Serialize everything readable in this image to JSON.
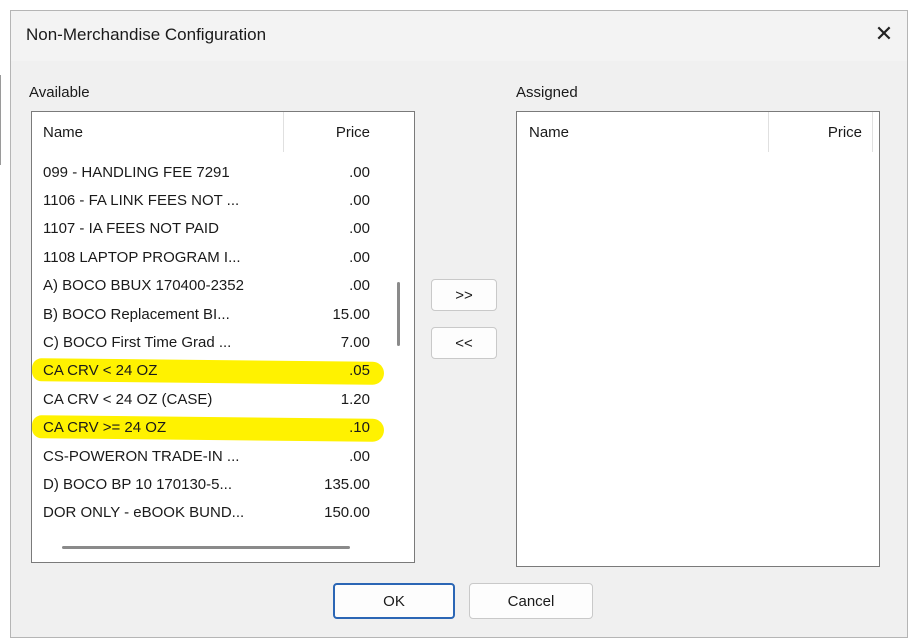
{
  "window": {
    "title": "Non-Merchandise Configuration",
    "close_glyph": "✕"
  },
  "available": {
    "label": "Available",
    "columns": {
      "name": "Name",
      "price": "Price"
    },
    "rows": [
      {
        "name": "099 - HANDLING FEE 7291",
        "price": ".00",
        "highlighted": false
      },
      {
        "name": "1106 - FA LINK FEES NOT ...",
        "price": ".00",
        "highlighted": false
      },
      {
        "name": "1107 - IA FEES NOT PAID",
        "price": ".00",
        "highlighted": false
      },
      {
        "name": "1108 LAPTOP PROGRAM I...",
        "price": ".00",
        "highlighted": false
      },
      {
        "name": "A) BOCO BBUX 170400-2352",
        "price": ".00",
        "highlighted": false
      },
      {
        "name": "B) BOCO Replacement BI...",
        "price": "15.00",
        "highlighted": false
      },
      {
        "name": "C) BOCO First Time Grad ...",
        "price": "7.00",
        "highlighted": false
      },
      {
        "name": "CA CRV < 24 OZ",
        "price": ".05",
        "highlighted": true
      },
      {
        "name": "CA CRV < 24 OZ (CASE)",
        "price": "1.20",
        "highlighted": false
      },
      {
        "name": "CA CRV >= 24 OZ",
        "price": ".10",
        "highlighted": true
      },
      {
        "name": "CS-POWERON TRADE-IN ...",
        "price": ".00",
        "highlighted": false
      },
      {
        "name": "D) BOCO BP 10 170130-5...",
        "price": "135.00",
        "highlighted": false
      },
      {
        "name": "DOR ONLY - eBOOK BUND...",
        "price": "150.00",
        "highlighted": false
      }
    ]
  },
  "assigned": {
    "label": "Assigned",
    "columns": {
      "name": "Name",
      "price": "Price"
    },
    "rows": []
  },
  "buttons": {
    "add": ">>",
    "remove": "<<",
    "ok": "OK",
    "cancel": "Cancel"
  },
  "colors": {
    "highlight": "#fff200",
    "default_button_border": "#2b66b5"
  }
}
